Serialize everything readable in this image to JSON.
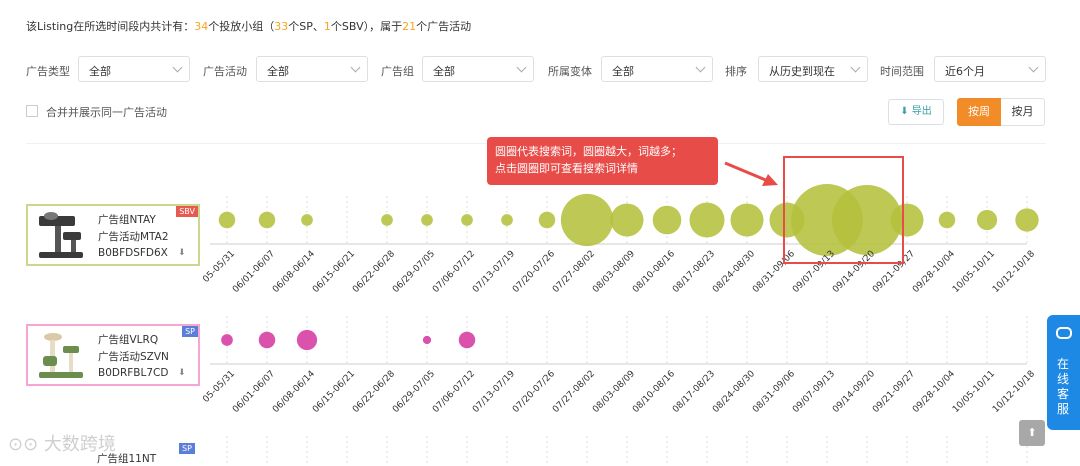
{
  "summary": {
    "p1": "该Listing在所选时间段内共计有：",
    "groups": "34",
    "p2": "个投放小组（",
    "sp": "33",
    "p3": "个SP、",
    "sbv": "1",
    "p4": "个SBV），属于",
    "campaigns": "21",
    "p5": "个广告活动"
  },
  "filters": [
    {
      "label": "广告类型",
      "value": "全部"
    },
    {
      "label": "广告活动",
      "value": "全部"
    },
    {
      "label": "广告组",
      "value": "全部"
    },
    {
      "label": "所属变体",
      "value": "全部"
    },
    {
      "label": "排序",
      "value": "从历史到现在"
    },
    {
      "label": "时间范围",
      "value": "近6个月"
    }
  ],
  "merge_label": "合并并展示同一广告活动",
  "export_label": "导出",
  "toggle": {
    "week": "按周",
    "month": "按月"
  },
  "tooltip": {
    "line1": "圆圈代表搜索词，圆圈越大，词越多；",
    "line2": "点击圆圈即可查看搜索词详情"
  },
  "weeks": [
    "05-05/31",
    "06/01-06/07",
    "06/08-06/14",
    "06/15-06/21",
    "06/22-06/28",
    "06/29-07/05",
    "07/06-07/12",
    "07/13-07/19",
    "07/20-07/26",
    "07/27-08/02",
    "08/03-08/09",
    "08/10-08/16",
    "08/17-08/23",
    "08/24-08/30",
    "08/31-09/06",
    "09/07-09/13",
    "09/14-09/20",
    "09/21-09/27",
    "09/28-10/04",
    "10/05-10/11",
    "10/12-10/18"
  ],
  "chart_data": [
    {
      "type": "scatter",
      "group": "广告组NTAY",
      "campaign": "广告活动MTA2",
      "asin": "B0BFDSFD6X",
      "ad_type": "SBV",
      "color": "#b5c03c",
      "bubble_sizes": [
        2,
        2,
        1,
        0,
        1,
        1,
        1,
        1,
        2,
        20,
        8,
        6,
        9,
        8,
        9,
        38,
        36,
        8,
        2,
        3,
        4
      ]
    },
    {
      "type": "scatter",
      "group": "广告组VLRQ",
      "campaign": "广告活动SZVN",
      "asin": "B0DRFBL7CD",
      "ad_type": "SP",
      "color": "#d63aa0",
      "bubble_sizes": [
        1,
        2,
        3,
        0,
        0,
        0.5,
        2,
        0,
        0,
        0,
        0,
        0,
        0,
        0,
        0,
        0,
        0,
        0,
        0,
        0,
        0
      ]
    }
  ],
  "third_row": {
    "group": "广告组11NT",
    "ad_type": "SP"
  },
  "customer_service": "在线客服",
  "watermark": "大数跨境"
}
